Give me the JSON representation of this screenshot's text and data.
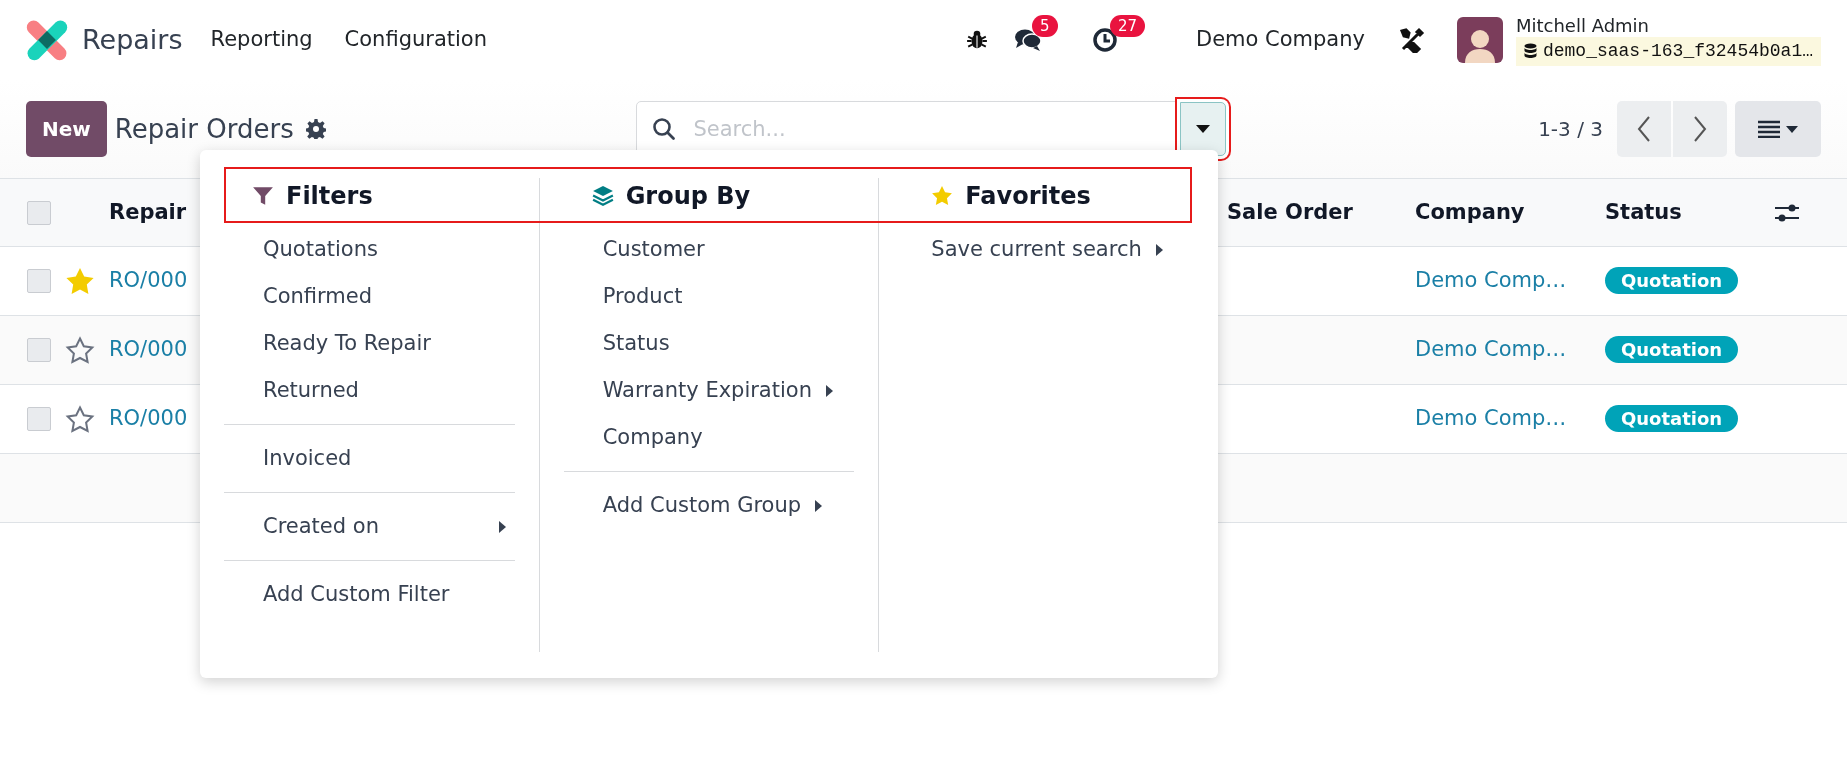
{
  "app": {
    "name": "Repairs",
    "menu": [
      {
        "label": "Reporting"
      },
      {
        "label": "Configuration"
      }
    ]
  },
  "systray": {
    "messages_count": "5",
    "activities_count": "27",
    "company": "Demo Company",
    "user": {
      "name": "Mitchell Admin",
      "database": "demo_saas-163_f32454b0a1…"
    }
  },
  "control_panel": {
    "new_button": "New",
    "title": "Repair Orders",
    "search": {
      "placeholder": "Search..."
    },
    "toggle_highlighted": true,
    "pager": "1-3 / 3"
  },
  "table": {
    "select_all_checked": false,
    "columns": [
      {
        "label": "Repair"
      },
      {
        "label": "Sale Order"
      },
      {
        "label": "Company"
      },
      {
        "label": "Status"
      }
    ],
    "rows": [
      {
        "checked": false,
        "starred": true,
        "reference": "RO/000",
        "company": "Demo Comp…",
        "status": "Quotation"
      },
      {
        "checked": false,
        "starred": false,
        "reference": "RO/000",
        "company": "Demo Comp…",
        "status": "Quotation"
      },
      {
        "checked": false,
        "starred": false,
        "reference": "RO/000",
        "company": "Demo Comp…",
        "status": "Quotation"
      }
    ]
  },
  "search_panel": {
    "headers_highlighted": true,
    "sections": [
      {
        "kind": "filters",
        "title": "Filters",
        "groups": [
          {
            "items": [
              {
                "label": "Quotations",
                "submenu": false
              },
              {
                "label": "Confirmed",
                "submenu": false
              },
              {
                "label": "Ready To Repair",
                "submenu": false
              },
              {
                "label": "Returned",
                "submenu": false
              }
            ]
          },
          {
            "items": [
              {
                "label": "Invoiced",
                "submenu": false
              }
            ]
          },
          {
            "items": [
              {
                "label": "Created on",
                "submenu": true
              }
            ]
          },
          {
            "items": [
              {
                "label": "Add Custom Filter",
                "submenu": false
              }
            ]
          }
        ]
      },
      {
        "kind": "groupby",
        "title": "Group By",
        "groups": [
          {
            "items": [
              {
                "label": "Customer",
                "submenu": false
              },
              {
                "label": "Product",
                "submenu": false
              },
              {
                "label": "Status",
                "submenu": false
              },
              {
                "label": "Warranty Expiration",
                "submenu": true
              },
              {
                "label": "Company",
                "submenu": false
              }
            ]
          },
          {
            "items": [
              {
                "label": "Add Custom Group",
                "submenu": true
              }
            ]
          }
        ]
      },
      {
        "kind": "favorites",
        "title": "Favorites",
        "groups": [
          {
            "items": [
              {
                "label": "Save current search",
                "submenu": true
              }
            ]
          }
        ]
      }
    ]
  }
}
